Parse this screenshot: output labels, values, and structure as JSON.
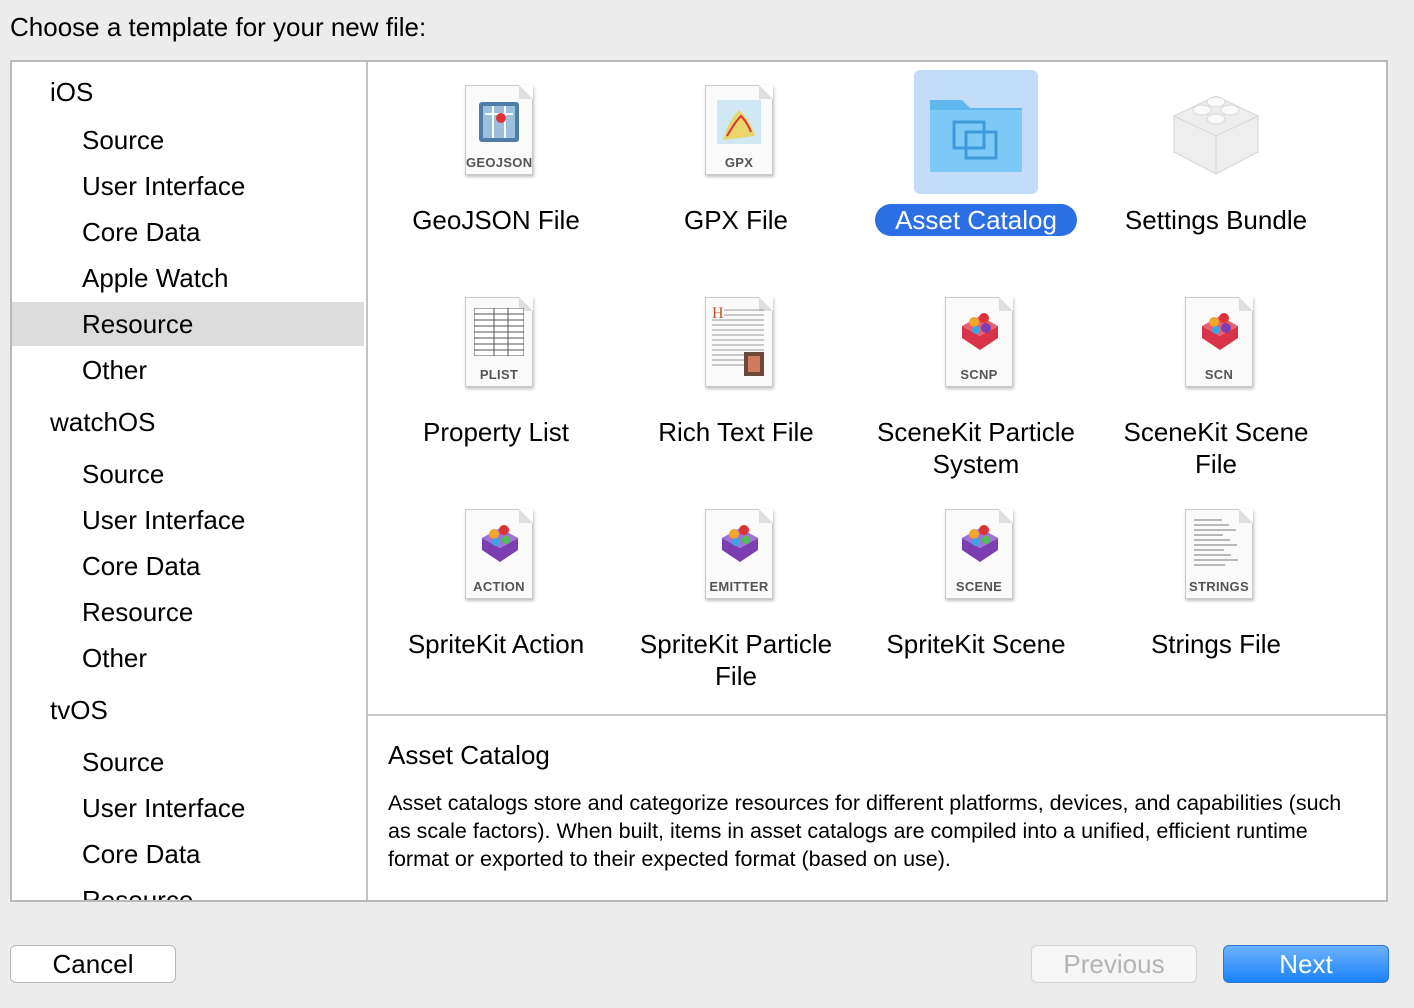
{
  "dialog": {
    "title": "Choose a template for your new file:"
  },
  "sidebar": {
    "rows": [
      {
        "label": "iOS",
        "type": "header"
      },
      {
        "label": "Source",
        "type": "item"
      },
      {
        "label": "User Interface",
        "type": "item"
      },
      {
        "label": "Core Data",
        "type": "item"
      },
      {
        "label": "Apple Watch",
        "type": "item"
      },
      {
        "label": "Resource",
        "type": "item",
        "selected": true
      },
      {
        "label": "Other",
        "type": "item"
      },
      {
        "label": "watchOS",
        "type": "header"
      },
      {
        "label": "Source",
        "type": "item"
      },
      {
        "label": "User Interface",
        "type": "item"
      },
      {
        "label": "Core Data",
        "type": "item"
      },
      {
        "label": "Resource",
        "type": "item"
      },
      {
        "label": "Other",
        "type": "item"
      },
      {
        "label": "tvOS",
        "type": "header"
      },
      {
        "label": "Source",
        "type": "item"
      },
      {
        "label": "User Interface",
        "type": "item"
      },
      {
        "label": "Core Data",
        "type": "item"
      },
      {
        "label": "Resource",
        "type": "item"
      }
    ]
  },
  "templates": [
    {
      "label": "GeoJSON File",
      "icon": "geojson-file-icon",
      "tag": "GEOJSON"
    },
    {
      "label": "GPX File",
      "icon": "gpx-file-icon",
      "tag": "GPX"
    },
    {
      "label": "Asset Catalog",
      "icon": "folder-icon",
      "tag": "",
      "selected": true
    },
    {
      "label": "Settings Bundle",
      "icon": "lego-block-icon",
      "tag": ""
    },
    {
      "label": "Property List",
      "icon": "plist-file-icon",
      "tag": "PLIST"
    },
    {
      "label": "Rich Text File",
      "icon": "rich-text-file-icon",
      "tag": ""
    },
    {
      "label": "SceneKit Particle System",
      "icon": "scenekit-particle-icon",
      "tag": "SCNP"
    },
    {
      "label": "SceneKit Scene File",
      "icon": "scenekit-scene-icon",
      "tag": "SCN"
    },
    {
      "label": "SpriteKit Action",
      "icon": "spritekit-action-icon",
      "tag": "ACTION"
    },
    {
      "label": "SpriteKit Particle File",
      "icon": "spritekit-particle-icon",
      "tag": "EMITTER"
    },
    {
      "label": "SpriteKit Scene",
      "icon": "spritekit-scene-icon",
      "tag": "SCENE"
    },
    {
      "label": "Strings File",
      "icon": "strings-file-icon",
      "tag": "STRINGS"
    }
  ],
  "description": {
    "title": "Asset Catalog",
    "body": "Asset catalogs store and categorize resources for different platforms, devices, and capabilities (such as scale factors).  When built, items in asset catalogs are compiled into a unified, efficient runtime format or exported to their expected format (based on use)."
  },
  "buttons": {
    "cancel": "Cancel",
    "previous": "Previous",
    "next": "Next"
  },
  "colors": {
    "selection": "#2b6fe4",
    "accent": "#1a82fb"
  }
}
